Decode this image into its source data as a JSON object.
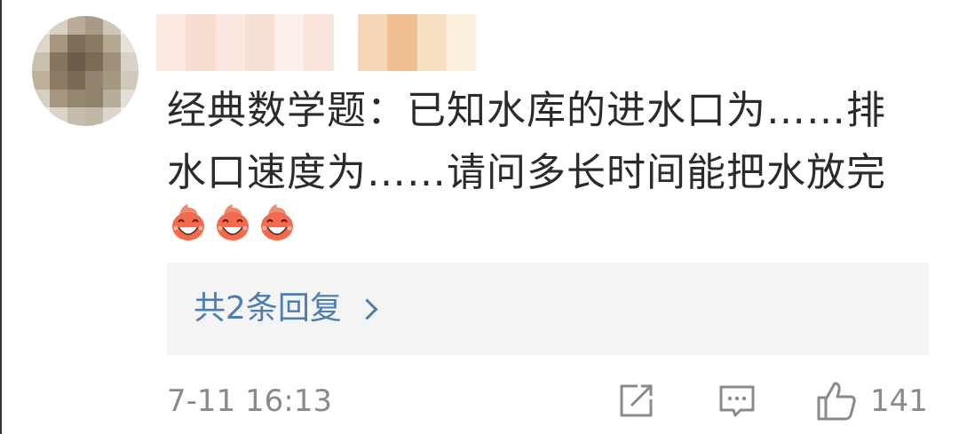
{
  "comment": {
    "avatar_icon": "avatar-pixelated",
    "username_icon": "username-pixelated",
    "line1": "经典数学题：已知水库的进水口为……排",
    "line2": "水口速度为……请问多长时间能把水放完",
    "emojis": [
      "laughing-emoji",
      "laughing-emoji",
      "laughing-emoji"
    ],
    "replies_label": "共2条回复",
    "timestamp": "7-11 16:13",
    "like_count": "141"
  },
  "icons": {
    "share": "share-icon",
    "reply": "comment-icon",
    "like": "thumbs-up-icon",
    "chevron": "chevron-right-icon"
  },
  "colors": {
    "link": "#4f7db0",
    "meta": "#8a8a8a",
    "reply_box": "#f4f4f4",
    "emoji_face": "#f26b4e"
  }
}
